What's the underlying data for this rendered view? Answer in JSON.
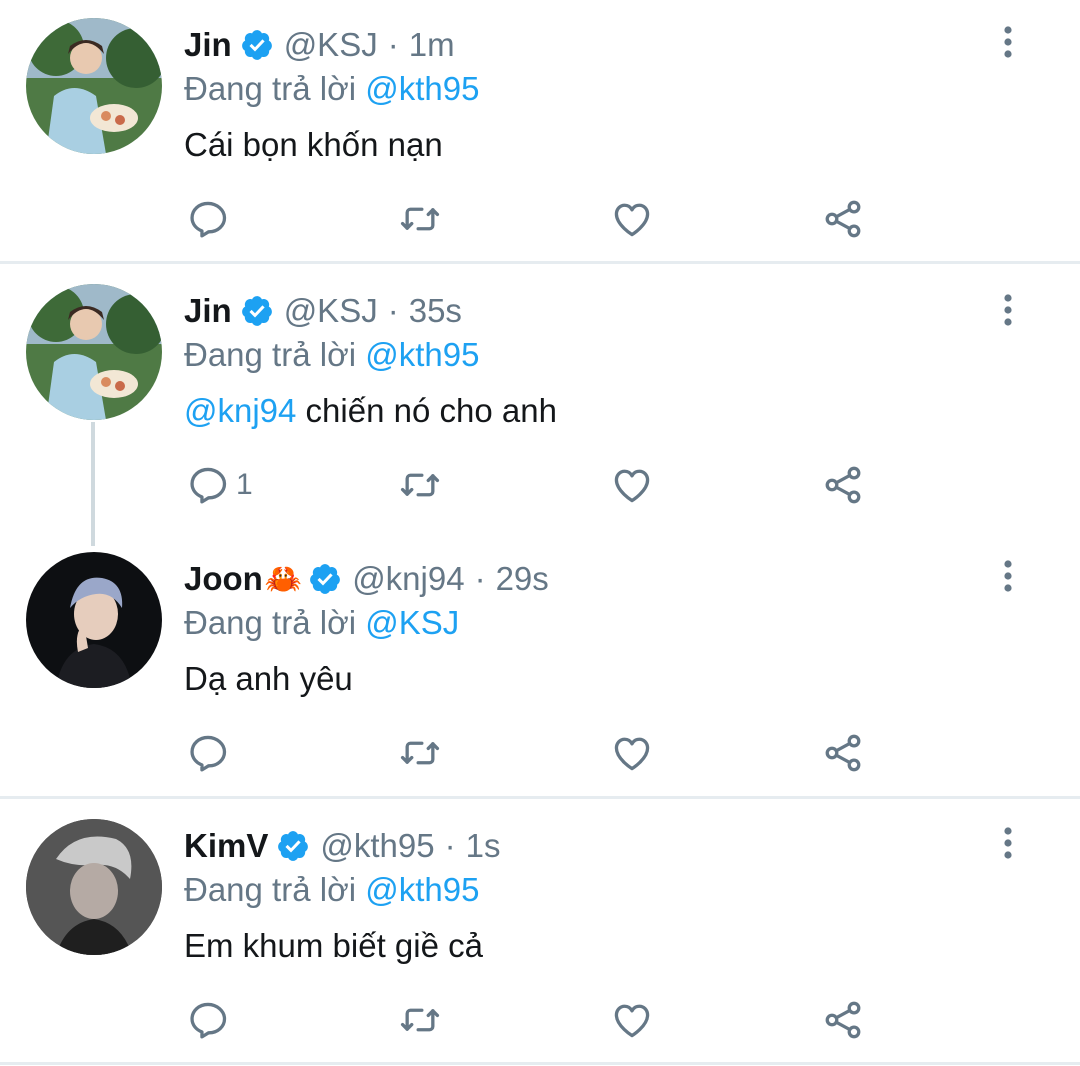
{
  "reply_prefix": "Đang trả lời",
  "colors": {
    "accent": "#1da1f2",
    "muted": "#657786",
    "text": "#14171a",
    "divider": "#e6ecf0"
  },
  "tweets": [
    {
      "name": "Jin",
      "emoji": "",
      "handle": "@KSJ",
      "time": "1m",
      "reply_to": "@kth95",
      "mention": "",
      "text": "Cái bọn khốn nạn",
      "reply_count": ""
    },
    {
      "name": "Jin",
      "emoji": "",
      "handle": "@KSJ",
      "time": "35s",
      "reply_to": "@kth95",
      "mention": "@knj94",
      "text": " chiến nó cho anh",
      "reply_count": "1"
    },
    {
      "name": "Joon",
      "emoji": "🦀",
      "handle": "@knj94",
      "time": "29s",
      "reply_to": "@KSJ",
      "mention": "",
      "text": "Dạ anh yêu",
      "reply_count": ""
    },
    {
      "name": "KimV",
      "emoji": "",
      "handle": "@kth95",
      "time": "1s",
      "reply_to": "@kth95",
      "mention": "",
      "text": "Em khum biết giề cả",
      "reply_count": ""
    }
  ],
  "separator": "·",
  "icons": {
    "verified": "verified-badge-icon",
    "reply": "reply-icon",
    "retweet": "retweet-icon",
    "like": "like-icon",
    "share": "share-icon",
    "more": "more-vertical-icon"
  }
}
